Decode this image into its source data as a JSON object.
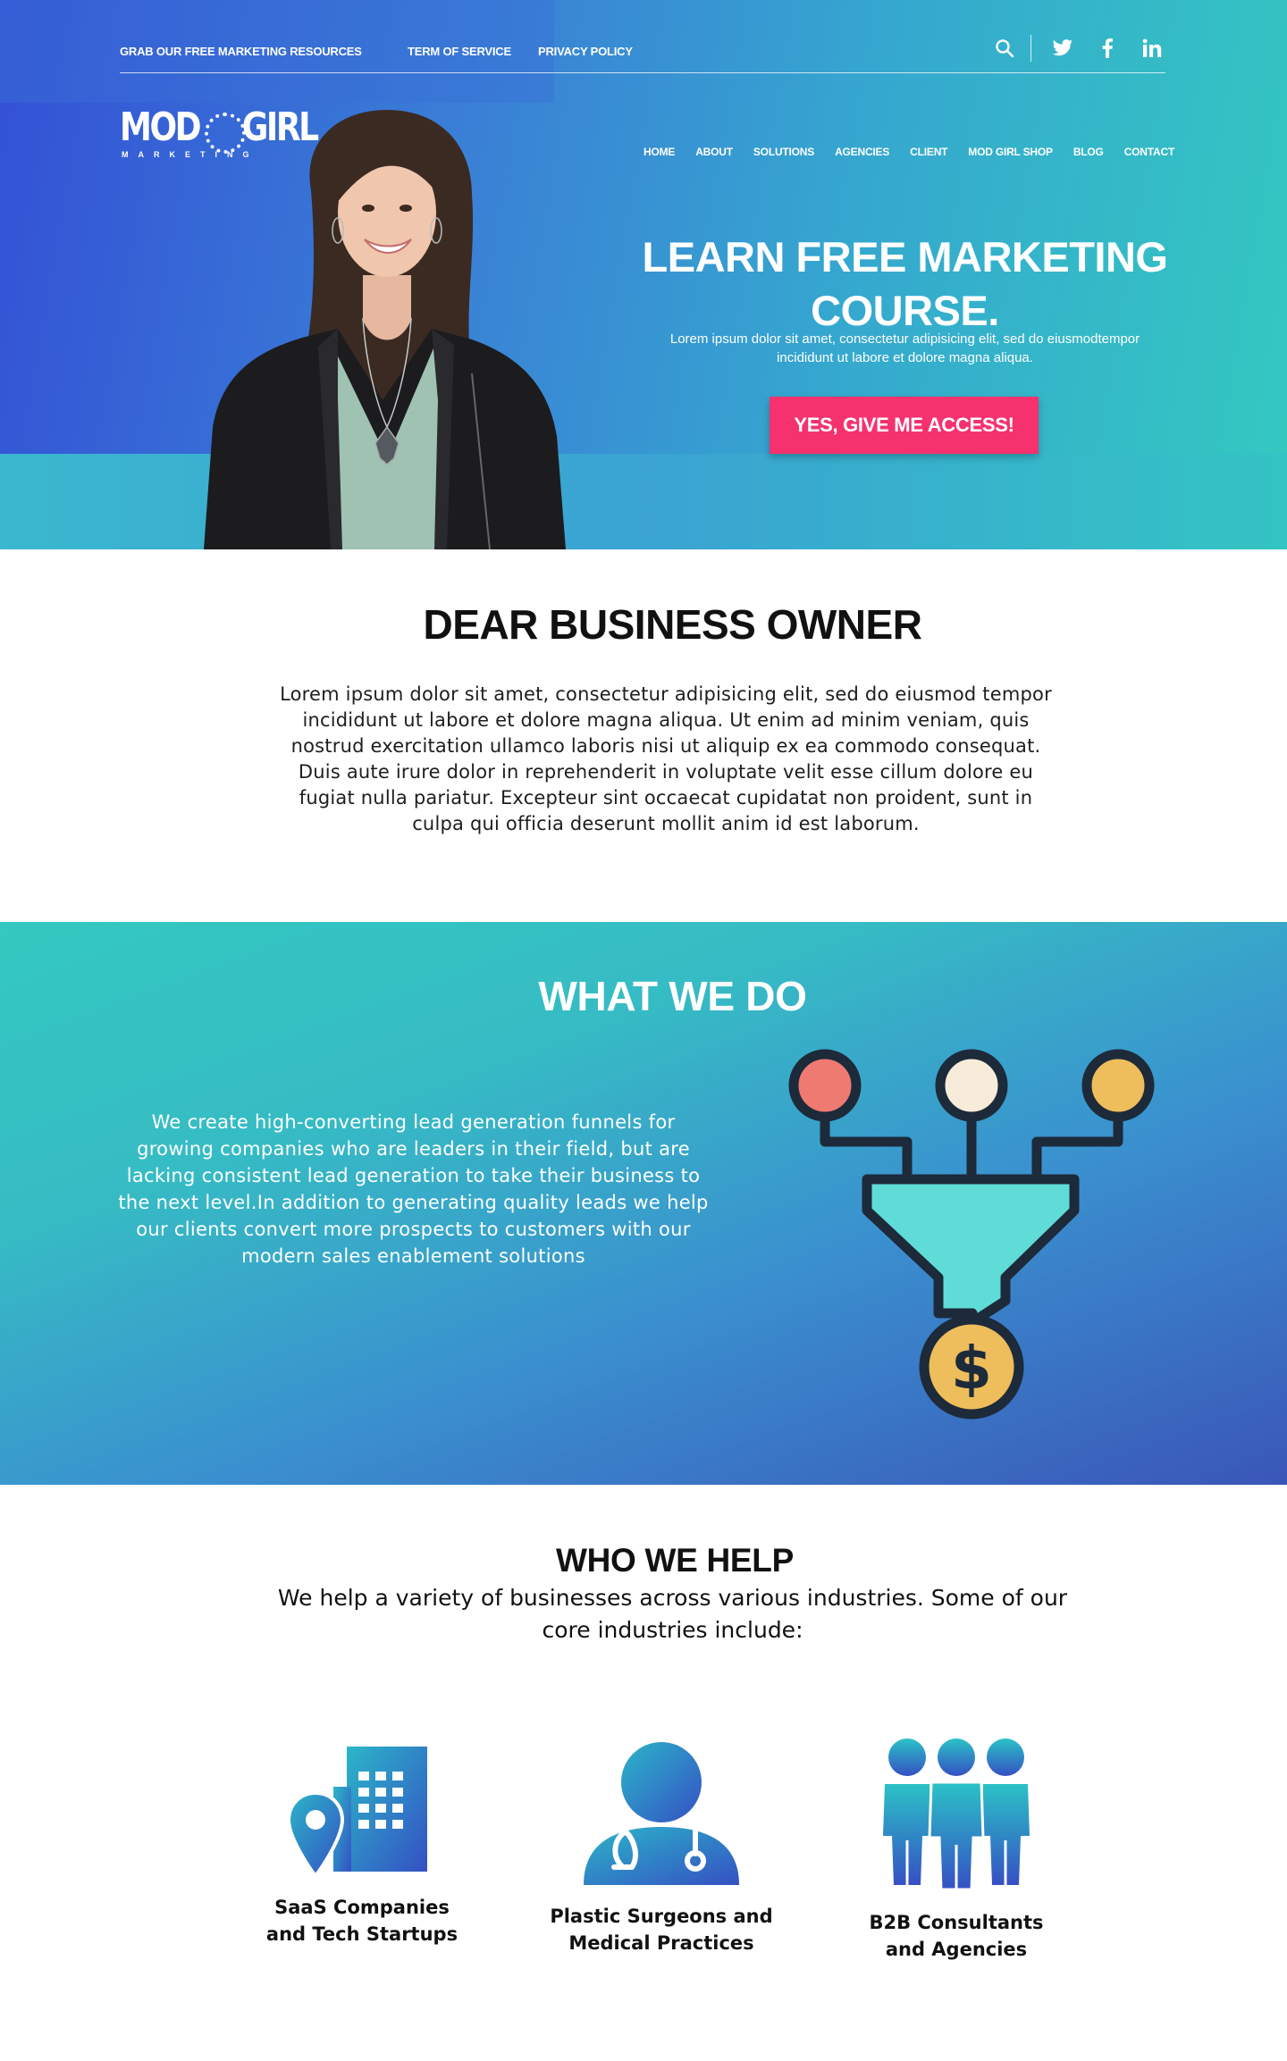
{
  "topbar": {
    "links": [
      "GRAB OUR FREE MARKETING RESOURCES",
      "TERM OF SERVICE",
      "PRIVACY POLICY"
    ],
    "icons": [
      "search-icon",
      "twitter-icon",
      "facebook-icon",
      "linkedin-icon"
    ]
  },
  "logo": {
    "left": "MOD",
    "right": "GIRL",
    "subtitle": "MARKETING"
  },
  "nav": {
    "items": [
      "HOME",
      "ABOUT",
      "SOLUTIONS",
      "AGENCIES",
      "CLIENT",
      "MOD GIRL SHOP",
      "BLOG",
      "CONTACT"
    ]
  },
  "hero": {
    "title": "LEARN FREE MARKETING COURSE.",
    "subtitle": "Lorem ipsum dolor sit amet, consectetur adipisicing elit, sed do eiusmodtempor incididunt ut labore et dolore magna aliqua.",
    "cta": "YES, GIVE  ME ACCESS!"
  },
  "dear": {
    "title": "DEAR BUSINESS OWNER",
    "body": "Lorem ipsum dolor sit amet, consectetur adipisicing elit, sed do eiusmod tempor incididunt ut labore et dolore magna aliqua. Ut enim ad minim veniam, quis nostrud exercitation ullamco laboris nisi ut aliquip ex ea commodo consequat. Duis aute irure dolor in reprehenderit in voluptate velit esse cillum dolore eu fugiat nulla pariatur. Excepteur sint occaecat cupidatat non proident, sunt in culpa qui officia deserunt mollit anim id est laborum."
  },
  "what_we_do": {
    "title": "WHAT WE DO",
    "body": "We create high-converting lead generation funnels for growing companies who are leaders in their field, but are lacking consistent lead generation to take their business to the next level.In addition to generating quality  leads we help our clients convert more prospects to customers with our modern sales enablement solutions"
  },
  "who_we_help": {
    "title": "WHO WE HELP",
    "subtitle": "We help a variety of businesses across various industries. Some of our core industries include:",
    "industries": [
      {
        "line1": "SaaS Companies",
        "line2": "and Tech Startups",
        "icon": "building-location-icon"
      },
      {
        "line1": "Plastic Surgeons and",
        "line2": "Medical Practices",
        "icon": "doctor-icon"
      },
      {
        "line1": "B2B Consultants",
        "line2": "and Agencies",
        "icon": "people-group-icon"
      }
    ]
  },
  "colors": {
    "cta": "#f5326e",
    "hero_blue": "#3350d6",
    "teal": "#34c9c0",
    "funnel_teal": "#5fdcd8",
    "dot_red": "#ee7a72",
    "dot_cream": "#f6ecd9",
    "dot_yellow": "#eebd5c"
  }
}
